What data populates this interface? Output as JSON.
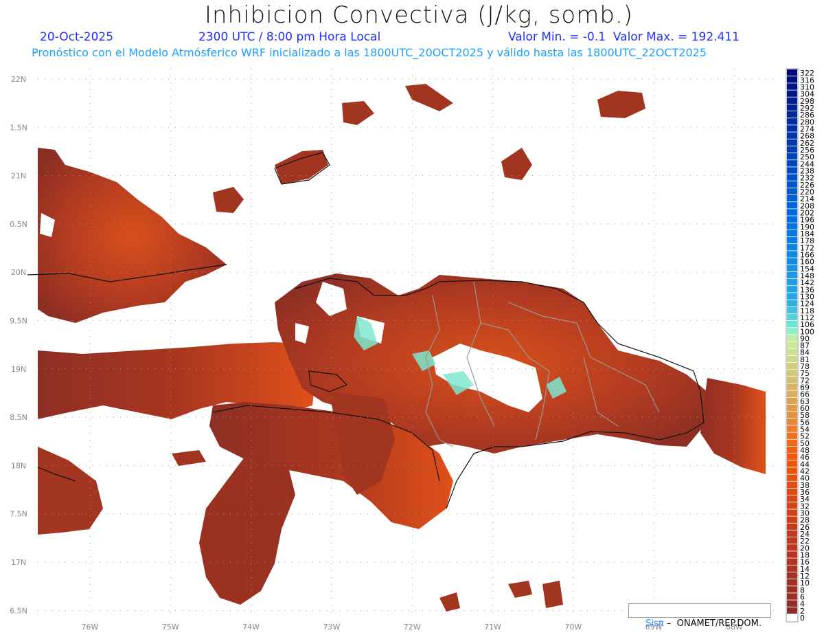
{
  "title": "Inhibicion Convectiva (J/kg, somb.)",
  "date": "20-Oct-2025",
  "time": "2300 UTC / 8:00 pm Hora Local",
  "minmax": "Valor Min. = -0.1  Valor Max. = 192.411",
  "subtitle": "Pronóstico con el Modelo Atmósferico WRF inicializado a las 1800UTC_20OCT2025 y válido hasta las  1800UTC_22OCT2025",
  "lon_ticks": [
    "76W",
    "75W",
    "74W",
    "73W",
    "72W",
    "71W",
    "70W",
    "69W",
    "68W"
  ],
  "lat_ticks": [
    "22N",
    "1.5N",
    "21N",
    "0.5N",
    "20N",
    "9.5N",
    "19N",
    "8.5N",
    "18N",
    "7.5N",
    "17N",
    "6.5N"
  ],
  "colorbar_labels": [
    "322",
    "316",
    "310",
    "304",
    "298",
    "292",
    "286",
    "280",
    "274",
    "268",
    "262",
    "256",
    "250",
    "244",
    "238",
    "232",
    "226",
    "220",
    "214",
    "208",
    "202",
    "196",
    "190",
    "184",
    "178",
    "172",
    "166",
    "160",
    "154",
    "148",
    "142",
    "136",
    "130",
    "124",
    "118",
    "112",
    "106",
    "100",
    "90",
    "87",
    "84",
    "81",
    "78",
    "75",
    "72",
    "69",
    "66",
    "63",
    "60",
    "58",
    "56",
    "54",
    "52",
    "50",
    "48",
    "46",
    "44",
    "42",
    "40",
    "38",
    "36",
    "34",
    "32",
    "30",
    "28",
    "26",
    "24",
    "22",
    "20",
    "18",
    "16",
    "14",
    "12",
    "10",
    "8",
    "6",
    "4",
    "2",
    "0"
  ],
  "credit": {
    "brand": "Sisπ",
    "text": " –  ONAMET/REP.DOM."
  },
  "colors": {
    "dark": "#8e2f24",
    "mid": "#c8401a",
    "orange": "#f55a0e",
    "cyan": "#7ee8d0",
    "title_blue": "#2030ff",
    "sub_blue": "#1aa0ff"
  }
}
